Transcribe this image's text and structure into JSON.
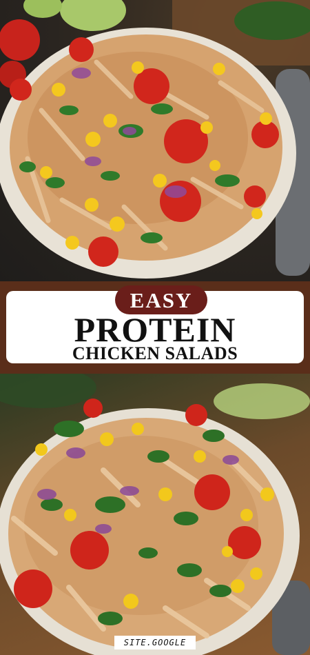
{
  "banner": {
    "tag": "EASY",
    "title": "PROTEIN",
    "subtitle": "CHICKEN SALADS"
  },
  "watermark": {
    "text": "SITE.GOOGLE"
  },
  "images": {
    "top": "chicken-salad-bowl-photo",
    "bottom": "chicken-salad-bowl-closeup-photo"
  },
  "colors": {
    "banner_bg": "#5a2e1a",
    "pill_bg": "#6a1e1a",
    "card_bg": "#ffffff",
    "text": "#111111"
  }
}
